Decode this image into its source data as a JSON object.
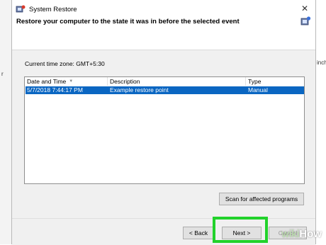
{
  "window": {
    "title": "System Restore",
    "close_symbol": "✕",
    "header": "Restore your computer to the state it was in before the selected event"
  },
  "timezone": "Current time zone: GMT+5:30",
  "table": {
    "columns": [
      "Date and Time",
      "Description",
      "Type"
    ],
    "rows": [
      {
        "date": "5/7/2018 7:44:17 PM",
        "description": "Example restore point",
        "type": "Manual"
      }
    ]
  },
  "buttons": {
    "scan": "Scan for affected programs",
    "back": "< Back",
    "next": "Next >",
    "cancel": "Cancel"
  },
  "background": {
    "right_fragment": "incha",
    "left_fragment": "r"
  },
  "watermark": {
    "wiki": "wiki",
    "how": "How"
  },
  "colors": {
    "selection": "#0a66c2",
    "highlight": "#22d22b"
  }
}
